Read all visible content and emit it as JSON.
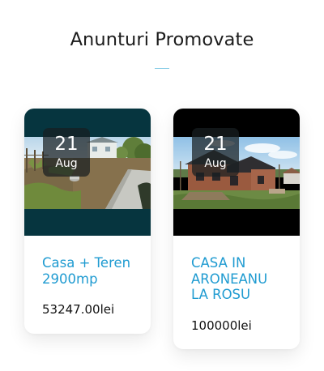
{
  "section": {
    "title": "Anunturi Promovate",
    "accent_color": "#88cde6"
  },
  "listings": [
    {
      "date_day": "21",
      "date_month": "Aug",
      "title": "Casa + Teren 2900mp",
      "price": "53247.00lei",
      "photo": "yard-with-path-and-house-photo"
    },
    {
      "date_day": "21",
      "date_month": "Aug",
      "title": "CASA IN ARONEANU LA ROSU",
      "price": "100000lei",
      "photo": "brick-house-under-construction-photo"
    }
  ],
  "colors": {
    "title_link": "#1f9bd1",
    "card1_media_bg": "#06353f",
    "card2_media_bg": "#000000"
  }
}
